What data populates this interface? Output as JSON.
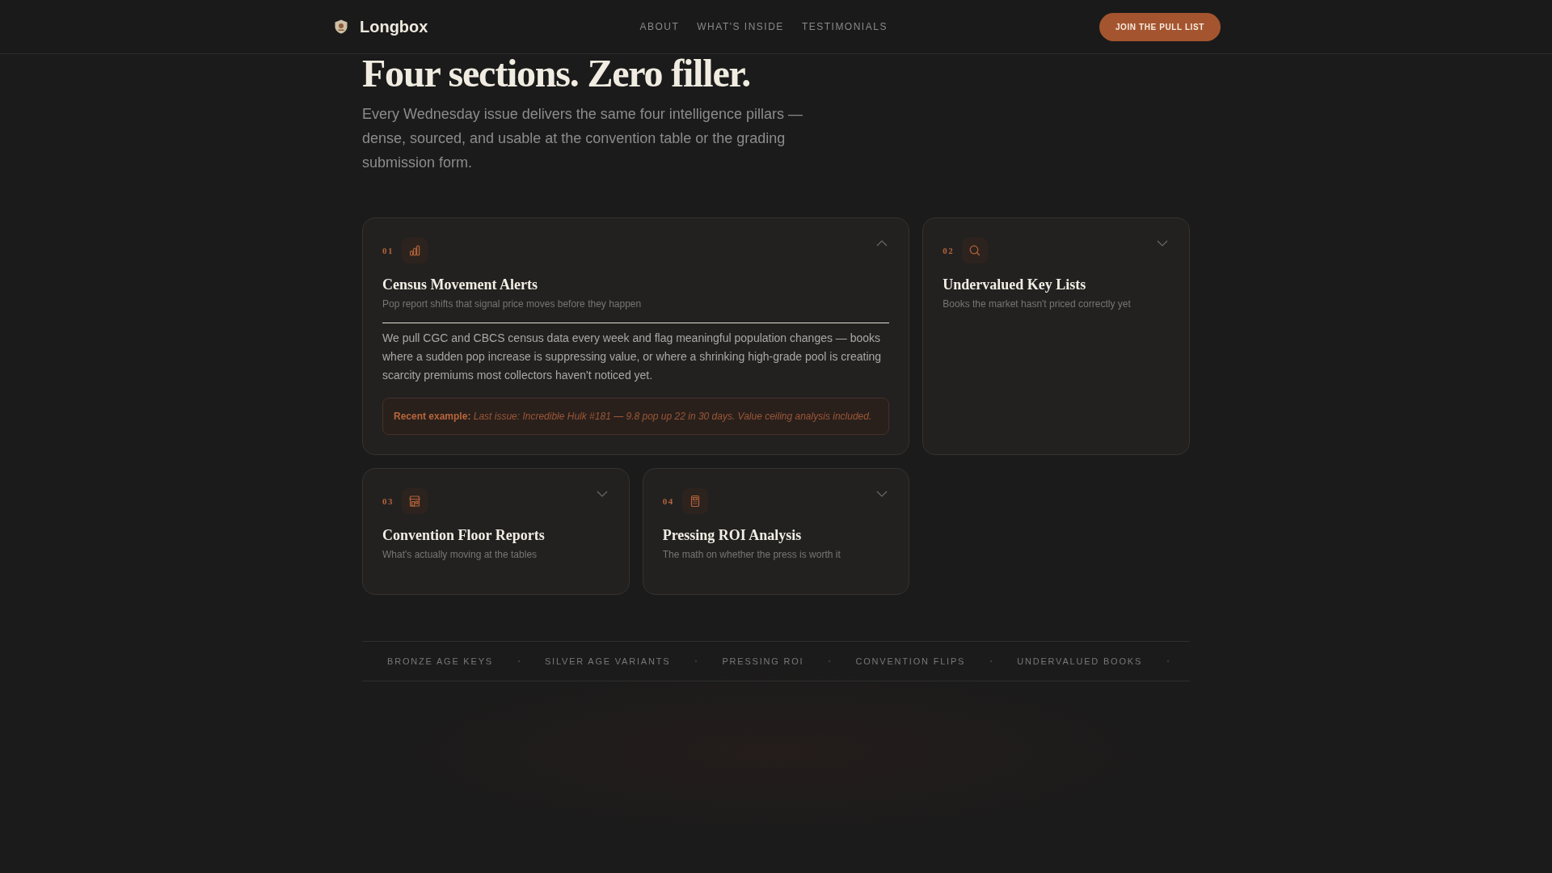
{
  "header": {
    "brand": "Longbox",
    "nav": [
      {
        "label": "ABOUT"
      },
      {
        "label": "WHAT'S INSIDE"
      },
      {
        "label": "TESTIMONIALS"
      }
    ],
    "cta": "JOIN THE PULL LIST"
  },
  "intro": {
    "title": "Four sections. Zero filler.",
    "description": "Every Wednesday issue delivers the same four intelligence pillars — dense, sourced, and usable at the convention table or the grading submission form."
  },
  "sections": [
    {
      "number": "01",
      "title": "Census Movement Alerts",
      "subtitle": "Pop report shifts that signal price moves before they happen",
      "expanded": true,
      "body": "We pull CGC and CBCS census data every week and flag meaningful population changes — books where a sudden pop increase is suppressing value, or where a shrinking high-grade pool is creating scarcity premiums most collectors haven't noticed yet.",
      "example": "**Recent example:** *Last issue: Incredible Hulk #181 — 9.8 pop up 22 in 30 days. Value ceiling analysis included.*"
    },
    {
      "number": "02",
      "title": "Undervalued Key Lists",
      "subtitle": "Books the market hasn't priced correctly yet",
      "expanded": false
    },
    {
      "number": "03",
      "title": "Convention Floor Reports",
      "subtitle": "What's actually moving at the tables",
      "expanded": false
    },
    {
      "number": "04",
      "title": "Pressing ROI Analysis",
      "subtitle": "The math on whether the press is worth it",
      "expanded": false
    }
  ],
  "topics": [
    "BRONZE AGE KEYS",
    "SILVER AGE VARIANTS",
    "PRESSING ROI",
    "CONVENTION FLIPS",
    "UNDERVALUED BOOKS"
  ]
}
